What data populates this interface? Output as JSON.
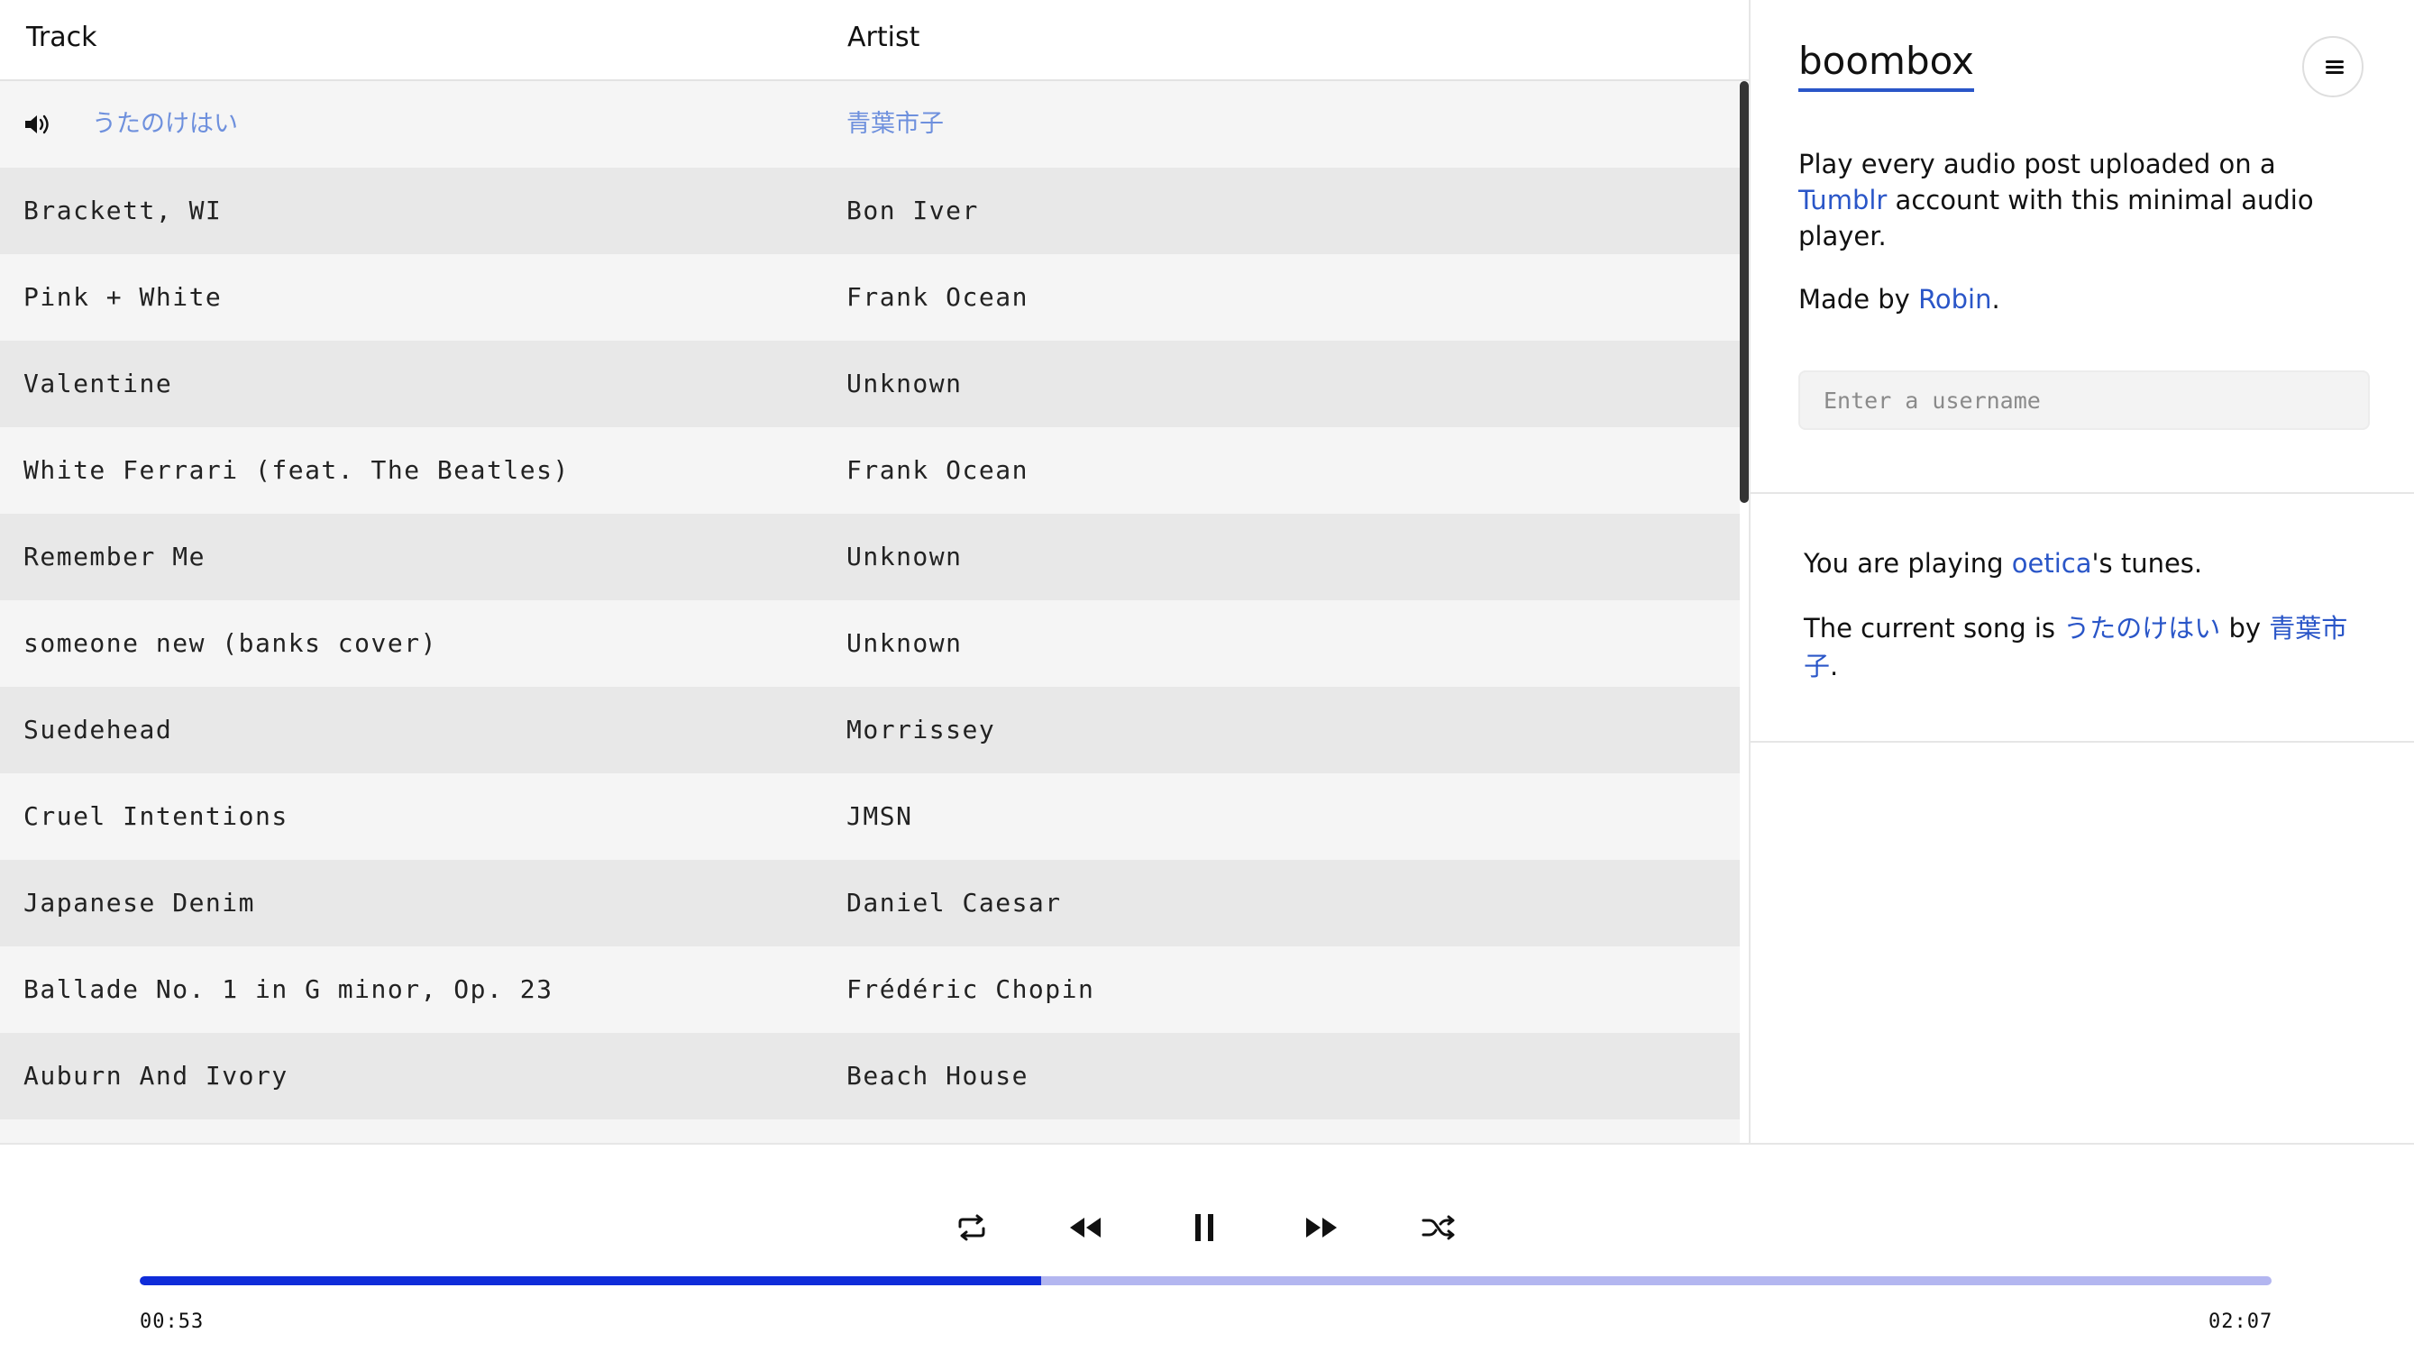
{
  "table": {
    "header": {
      "track": "Track",
      "artist": "Artist"
    },
    "rows": [
      {
        "track": "うたのけはい",
        "artist": "青葉市子"
      },
      {
        "track": "Brackett, WI",
        "artist": "Bon Iver"
      },
      {
        "track": "Pink + White",
        "artist": "Frank Ocean"
      },
      {
        "track": "Valentine",
        "artist": "Unknown"
      },
      {
        "track": "White Ferrari (feat. The Beatles)",
        "artist": "Frank Ocean"
      },
      {
        "track": "Remember Me",
        "artist": "Unknown"
      },
      {
        "track": "someone new (banks cover)",
        "artist": "Unknown"
      },
      {
        "track": "Suedehead",
        "artist": "Morrissey"
      },
      {
        "track": "Cruel Intentions",
        "artist": "JMSN"
      },
      {
        "track": "Japanese Denim",
        "artist": "Daniel Caesar"
      },
      {
        "track": "Ballade No. 1 in G minor, Op. 23",
        "artist": "Frédéric Chopin"
      },
      {
        "track": "Auburn And Ivory",
        "artist": "Beach House"
      }
    ],
    "now_playing_icon": "speaker-icon"
  },
  "sidebar": {
    "brand": "boombox",
    "menu_icon": "hamburger-icon",
    "about": {
      "line1_before": "Play every audio post uploaded on a",
      "tumblr_link": "Tumblr",
      "line1_after": "account with this minimal audio player.",
      "made_by_prefix": "Made by",
      "author_link": "Robin",
      "made_by_suffix": "."
    },
    "username_placeholder": "Enter a username",
    "status": {
      "playing_prefix": "You are playing",
      "user_link": "oetica",
      "playing_suffix": "'s tunes.",
      "current_prefix": "The current song is",
      "song_link": "うたのけはい",
      "by_word": "by",
      "artist_link": "青葉市子",
      "current_suffix": "."
    }
  },
  "player": {
    "controls": [
      "repeat-icon",
      "rewind-icon",
      "pause-icon",
      "fast-forward-icon",
      "shuffle-icon"
    ],
    "elapsed": "00:53",
    "duration": "02:07",
    "progress": 0.423,
    "colors": {
      "progress_fill": "#0f2cd9",
      "progress_track": "#b3b6f0",
      "link": "#2a56c8"
    }
  }
}
